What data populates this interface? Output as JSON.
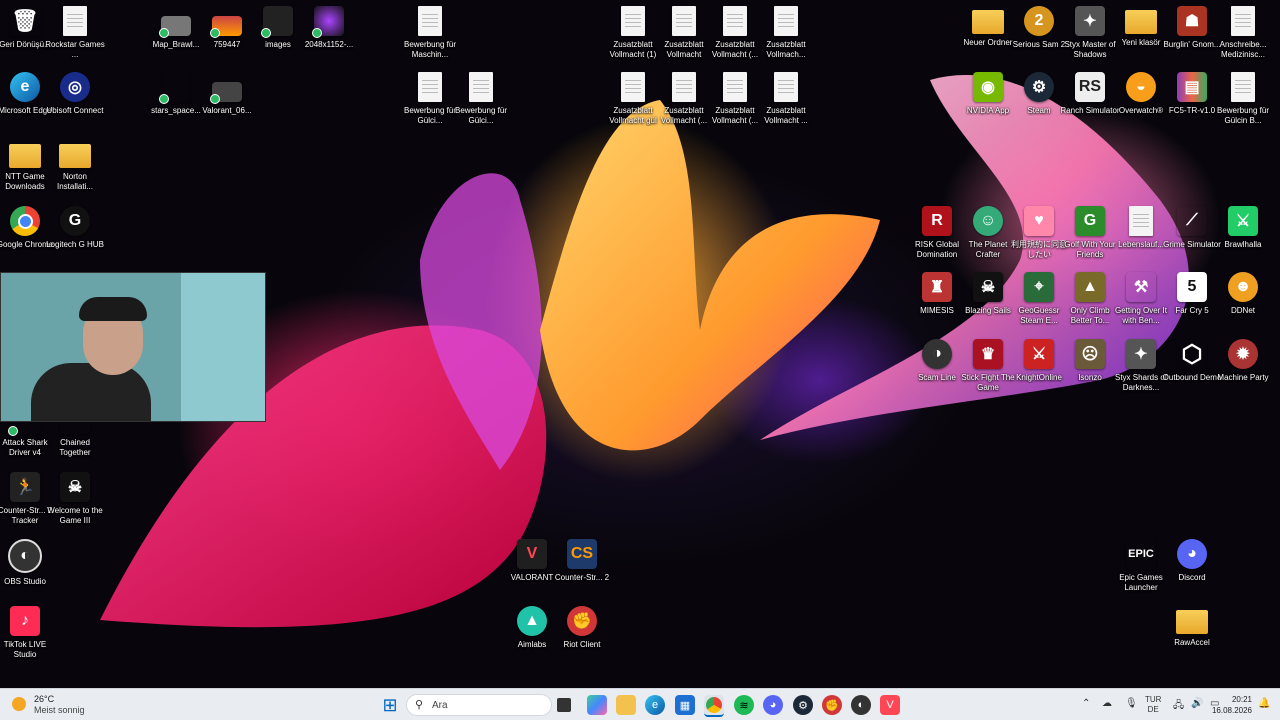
{
  "desktop_icons": {
    "recycle": "Geri Dönüşü...",
    "rockstar": "Rockstar Games ...",
    "map": "Map_Brawl...",
    "759447": "759447",
    "images": "images",
    "res2048": "2048x1152-...",
    "bew_masch": "Bewerbung für Maschin...",
    "zus1": "Zusatzblatt Vollmacht (1)",
    "zus2": "Zusatzblatt Vollmacht",
    "zus3": "Zusatzblatt Vollmacht (...",
    "zus4": "Zusatzblatt Vollmach...",
    "neuer": "Neuer Ordner",
    "serious": "Serious Sam 2",
    "styx_master": "Styx Master of Shadows",
    "yeni": "Yeni klasör",
    "burglin": "Burglin' Gnom...",
    "anschreibe": "Anschreibe... Medizinisc...",
    "edge": "Microsoft Edge",
    "ubisoft": "Ubisoft Connect",
    "stars": "stars_space...",
    "valorant06": "Valorant_06...",
    "bew_gulci1": "Bewerbung für Gülci...",
    "bew_gulci2": "Bewerbung für Gülci...",
    "zus5": "Zusatzblatt Vollmacht gül",
    "zus6": "Zusatzblatt Vollmacht (...",
    "zus7": "Zusatzblatt Vollmacht (...",
    "zus8": "Zusatzblatt Vollmacht ...",
    "nvidia": "NVIDIA App",
    "steam": "Steam",
    "ranch": "Ranch Simulator",
    "overwatch": "Overwatch®",
    "fc5": "FC5-TR-v1.0",
    "bew_gulcin": "Bewerbung für Gülcin B...",
    "ntt": "NTT Game Downloads",
    "norton": "Norton Installati...",
    "chrome": "Google Chrome",
    "logitech": "Logitech G HUB",
    "risk": "RISK Global Domination",
    "planet": "The Planet Crafter",
    "jp": "利用規約に同意したい",
    "golf": "Golf With Your Friends",
    "lebens": "Lebenslauf...",
    "grime": "Grime Simulator",
    "brawlhalla": "Brawlhalla",
    "mimesis": "MIMESIS",
    "blazing": "Blazing Sails",
    "geoguessr": "GeoGuessr Steam E...",
    "climb": "Only Climb Better To...",
    "gettingover": "Getting Over It with Ben...",
    "farcry": "Far Cry 5",
    "ddnet": "DDNet",
    "scam": "Scam Line",
    "stick": "Stick Fight The Game",
    "knight": "KnightOnline",
    "isonzo": "Isonzo",
    "styx_shards": "Styx Shards of Darknes...",
    "outbound": "Outbound Demo",
    "machine": "Machine Party",
    "attack": "Attack Shark Driver v4",
    "chained": "Chained Together",
    "cs2tracker": "Counter-Str... 2 Tracker",
    "welcome": "Welcome to the Game III",
    "valorant": "VALORANT",
    "cs2": "Counter-Str... 2",
    "obs": "OBS Studio",
    "aimlabs": "Aimlabs",
    "riot": "Riot Client",
    "epic": "Epic Games Launcher",
    "discord": "Discord",
    "tiktok": "TikTok LIVE Studio",
    "rawaccel": "RawAccel"
  },
  "weather": {
    "temp": "26°C",
    "desc": "Meist sonnig"
  },
  "search": {
    "placeholder": "Ara"
  },
  "tray": {
    "lang1": "TUR",
    "lang2": "DE",
    "time": "20:21",
    "date": "16.08.2026"
  },
  "colors": {
    "taskbar": "#e9edf2",
    "accent": "#0067c0"
  }
}
